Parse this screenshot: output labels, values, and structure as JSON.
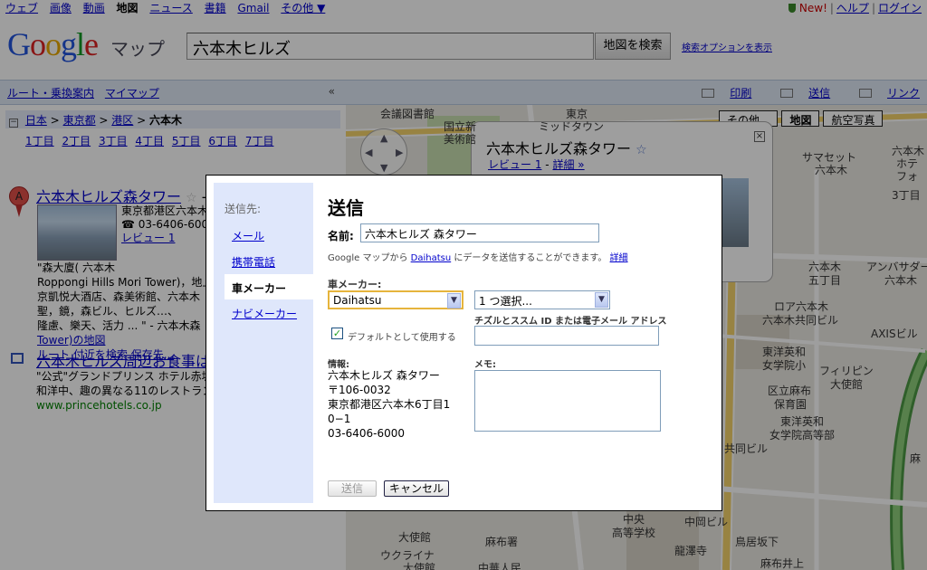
{
  "top_nav": {
    "links": [
      "ウェブ",
      "画像",
      "動画",
      "地図",
      "ニュース",
      "書籍",
      "Gmail",
      "その他 ▼"
    ],
    "current": "地図",
    "new_badge": "New!",
    "help": "ヘルプ",
    "login": "ログイン",
    "separator": "|"
  },
  "header": {
    "logo": [
      "G",
      "o",
      "o",
      "g",
      "l",
      "e"
    ],
    "product": "マップ",
    "search_value": "六本木ヒルズ",
    "search_button": "地図を検索",
    "search_options": "検索オプションを表示"
  },
  "left_panel": {
    "toolbar": {
      "route": "ルート・乗換案内",
      "mymaps": "マイマップ",
      "collapse": "«"
    },
    "breadcrumb": {
      "toggle": "−",
      "items": [
        "日本",
        "東京都",
        "港区"
      ],
      "current": "六本木",
      "separator": ">"
    },
    "chome": [
      "1丁目",
      "2丁目",
      "3丁目",
      "4丁目",
      "5丁目",
      "6丁目",
      "7丁目"
    ],
    "result1": {
      "marker": "A",
      "title": "六本木ヒルズ森タワー",
      "star": "☆",
      "suffix": "-",
      "address": "東京都港区六本木",
      "phone": "☎ 03-6406-600",
      "review": "レビュー 1",
      "desc_lines": [
        "\"森大廈( 六本木",
        "Roppongi Hills Mori Tower)，地上",
        "京凱悦大酒店、森美術館、六本木",
        "聖，鏡，森ビル、ヒルズ…、",
        "隆慮、樂天、活力 ... \" - 六本木森"
      ],
      "map_link": "Tower)の地図",
      "actions": [
        "ルート",
        "付近を検索",
        "保存先..."
      ]
    },
    "result2": {
      "title": "六本木ヒルズ周辺お食事は",
      "desc_lines": [
        "\"公式\"グランドプリンス ホテル赤坂",
        "和洋中、趣の異なる11のレストラン"
      ],
      "url": "www.princehotels.co.jp"
    }
  },
  "map": {
    "toolbar": {
      "print": "印刷",
      "send": "送信",
      "link": "リンク"
    },
    "map_types": [
      "その他...",
      "地図",
      "航空写真"
    ],
    "map_type_selected": "地図",
    "info_window": {
      "title": "六本木ヒルズ森タワー",
      "star": "☆",
      "review": "レビュー 1",
      "separator": "-",
      "details": "詳細 »",
      "close": "×"
    },
    "labels": [
      "会議図書館",
      "国立新",
      "美術館",
      "東京",
      "ミッドタウン",
      "六本木",
      "サマセット",
      "六本木",
      "3丁目",
      "ホテ",
      "フォ",
      "六本木",
      "五丁目",
      "アンバサダー",
      "六本木",
      "ロア六本木",
      "六本木共同ビル",
      "東洋英和",
      "女学院小",
      "AXISビル",
      "フィリピン",
      "大使館",
      "区立麻布",
      "保育園",
      "東洋英和",
      "女学院高等部",
      "共同ビル",
      "大使館",
      "中央",
      "高等学校",
      "中岡ビル",
      "鳥居坂下",
      "麻布署",
      "龍澤寺",
      "ウクライナ",
      "大使館",
      "中華人民",
      "麻布井上",
      "麻"
    ],
    "pan": {
      "up": "▲",
      "down": "▼",
      "left": "◀",
      "right": "▶"
    }
  },
  "dialog": {
    "nav_header": "送信先:",
    "nav_items": [
      "メール",
      "携帯電話",
      "車メーカー",
      "ナビメーカー"
    ],
    "nav_selected": "車メーカー",
    "title": "送信",
    "name_label": "名前:",
    "name_value": "六本木ヒルズ 森タワー",
    "help_text": "Google マップから",
    "help_link": "Daihatsu",
    "help_text2": "にデータを送信することができます。",
    "help_details": "詳細",
    "maker_label": "車メーカー:",
    "maker_value": "Daihatsu",
    "select_value": "1 つ選択...",
    "chizuru_label": "チズルとススム ID または電子メール アドレス",
    "default_label": "デフォルトとして使用する",
    "default_checked": "✓",
    "info_label": "情報:",
    "info_lines": [
      "六本木ヒルズ 森タワー",
      "〒106-0032",
      "東京都港区六本木6丁目1",
      "0−1",
      "03-6406-6000"
    ],
    "memo_label": "メモ:",
    "send_button": "送信",
    "cancel_button": "キャンセル",
    "dropdown_arrow": "▼"
  }
}
